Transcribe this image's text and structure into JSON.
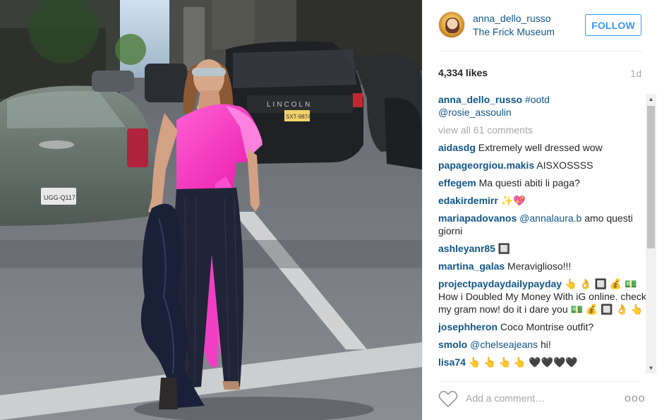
{
  "post": {
    "username": "anna_dello_russo",
    "location": "The Frick Museum",
    "follow_label": "FOLLOW",
    "likes": "4,334 likes",
    "age": "1d"
  },
  "photo": {
    "license_plate_left": "UGG-Q117",
    "license_plate_right": "SXT-9874",
    "car_brand": "LINCOLN"
  },
  "comments": {
    "caption": {
      "user": "anna_dello_russo",
      "hashtag": "#ootd",
      "mention": "@rosie_assoulin"
    },
    "view_all": "view all 61 comments",
    "items": [
      {
        "user": "aidasdg",
        "text": " Extremely well dressed wow"
      },
      {
        "user": "papageorgiou.makis",
        "text": " AISXOSSSS"
      },
      {
        "user": "effegem",
        "text": " Ma questi abiti li paga?"
      },
      {
        "user": "edakirdemirr",
        "text": " ✨💖"
      },
      {
        "user": "mariapadovanos",
        "mention": " @annalaura.b",
        "text": " amo questi giorni"
      },
      {
        "user": "ashleyanr85",
        "text": " 🔲"
      },
      {
        "user": "martina_galas",
        "text": " Meraviglioso!!!"
      },
      {
        "user": "projectpaydaydailypayday",
        "text": " 👆 👌 🔲 💰 💵 How i Doubled My Money With iG online. check my gram now! do it i dare you 💵 💰 🔲 👌 👆"
      },
      {
        "user": "josephheron",
        "text": " Coco Montrise outfit?"
      },
      {
        "user": "smolo",
        "mention": " @chelseajeans",
        "text": " hi!"
      },
      {
        "user": "lisa74",
        "text": " 👆 👆 👆 👆 🖤🖤🖤🖤"
      }
    ]
  },
  "footer": {
    "add_comment_placeholder": "Add a comment…",
    "more_label": "ooo"
  },
  "icons": {
    "heart": "heart-icon",
    "more": "more-options-icon",
    "avatar": "avatar"
  },
  "colors": {
    "link": "#125688",
    "follow": "#3897f0",
    "muted": "#a5a7aa"
  }
}
